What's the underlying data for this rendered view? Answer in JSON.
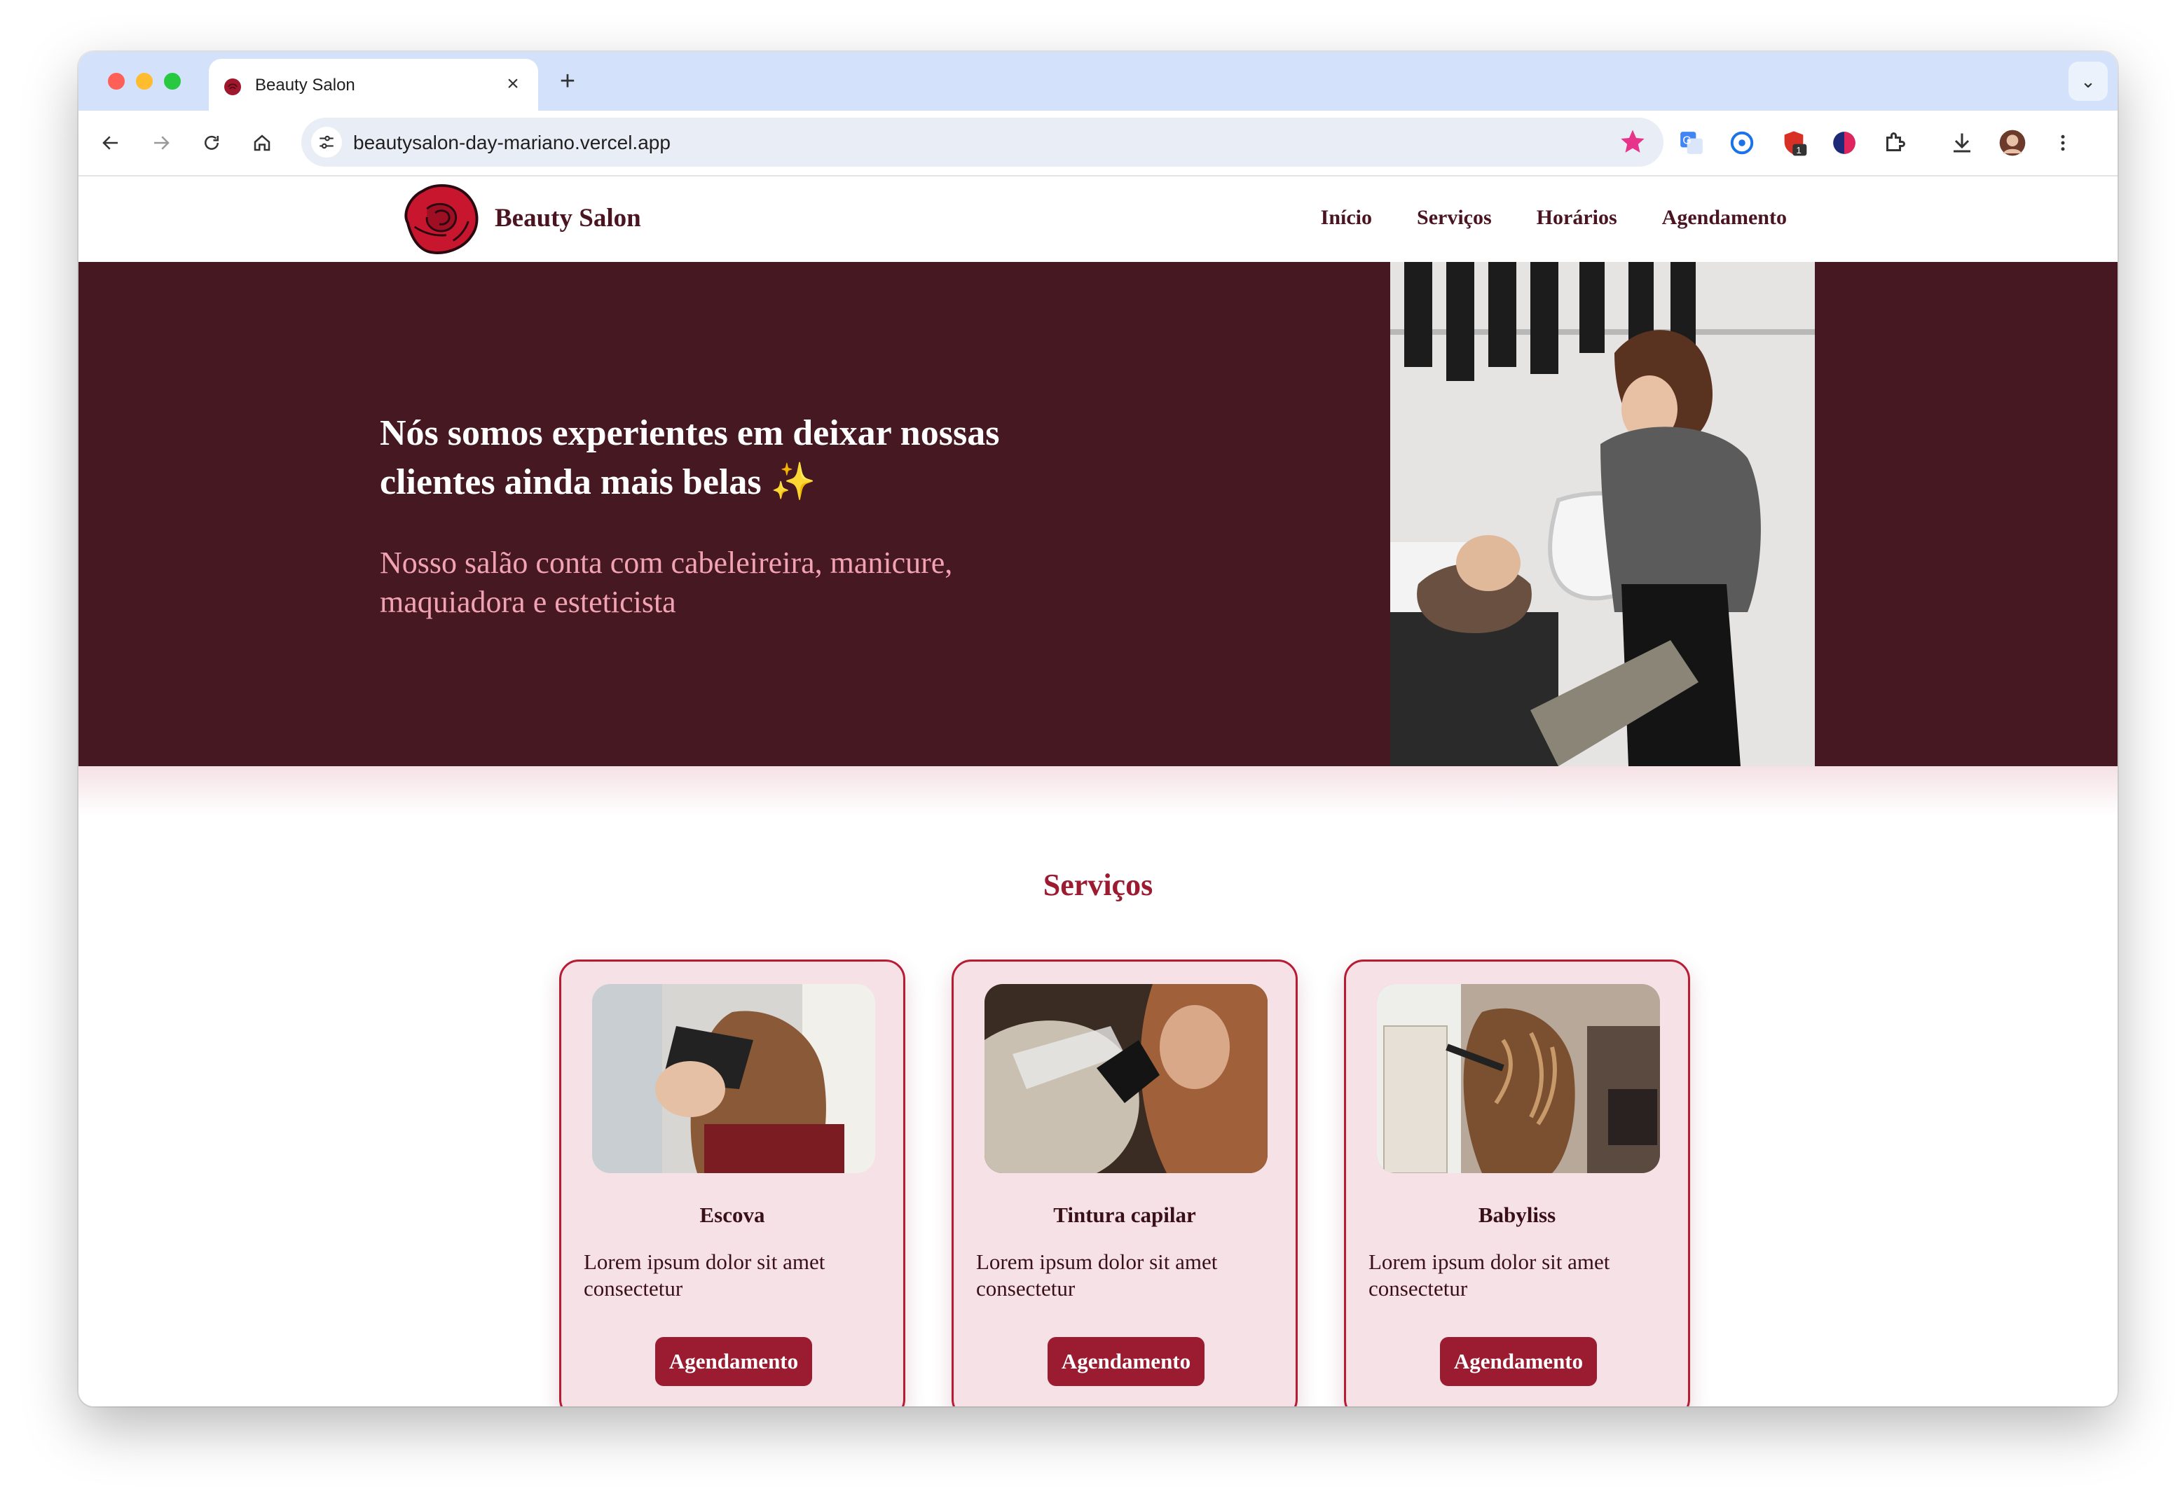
{
  "browser": {
    "tab_title": "Beauty Salon",
    "tab_close": "×",
    "new_tab": "+",
    "tab_menu": "⌄",
    "url": "beautysalon-day-mariano.vercel.app",
    "extension_badge": "1",
    "star_color": "#e8338a"
  },
  "site": {
    "brand": "Beauty Salon",
    "nav": [
      "Início",
      "Serviços",
      "Horários",
      "Agendamento"
    ],
    "hero": {
      "title": "Nós somos experientes em deixar nossas clientes ainda mais belas ✨",
      "subtitle": "Nosso salão conta com cabeleireira, manicure, maquiadora e esteticista"
    },
    "services": {
      "title": "Serviços",
      "cards": [
        {
          "name": "Escova",
          "text": "Lorem ipsum dolor sit amet consectetur",
          "button": "Agendamento"
        },
        {
          "name": "Tintura capilar",
          "text": "Lorem ipsum dolor sit amet consectetur",
          "button": "Agendamento"
        },
        {
          "name": "Babyliss",
          "text": "Lorem ipsum dolor sit amet consectetur",
          "button": "Agendamento"
        }
      ]
    }
  },
  "colors": {
    "hero_bg": "#461821",
    "accent": "#9b1c30",
    "card_bg": "#f6e2e6",
    "subtitle": "#f2a3b3"
  }
}
